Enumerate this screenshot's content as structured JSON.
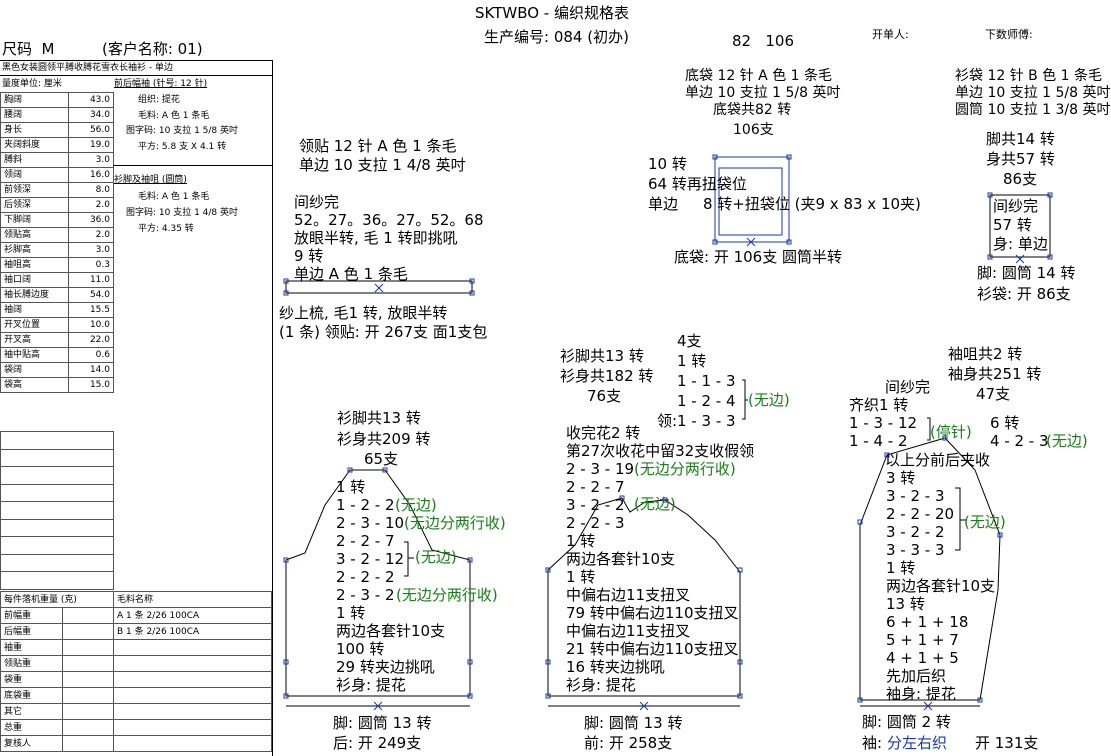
{
  "header": {
    "title": "SKTWBO - 编织规格表",
    "production_no": "生产编号: 084 (初办)",
    "numbers": "82   106",
    "opener_label": "开单人:",
    "counter_label": "下数师傅:",
    "size": "尺码  M",
    "client": "(客户名称: 01)"
  },
  "left": {
    "style_desc": "黑色女装圆领平膊收膊花雪衣长袖衫 - 单边",
    "unit_label": "量度单位: 厘米",
    "measurements": [
      {
        "label": "胸阔",
        "value": "43.0"
      },
      {
        "label": "腰阔",
        "value": "34.0"
      },
      {
        "label": "身长",
        "value": "56.0"
      },
      {
        "label": "夹阔斜度",
        "value": "19.0"
      },
      {
        "label": "膊斜",
        "value": "3.0"
      },
      {
        "label": "领阔",
        "value": "16.0"
      },
      {
        "label": "前领深",
        "value": "8.0"
      },
      {
        "label": "后领深",
        "value": "2.0"
      },
      {
        "label": "下脚阔",
        "value": "36.0"
      },
      {
        "label": "领贴高",
        "value": "2.0"
      },
      {
        "label": "衫脚高",
        "value": "3.0"
      },
      {
        "label": "袖咀高",
        "value": "0.3"
      },
      {
        "label": "袖口阔",
        "value": "11.0"
      },
      {
        "label": "袖长膊边度",
        "value": "54.0"
      },
      {
        "label": "袖阔",
        "value": "15.5"
      },
      {
        "label": "开叉位置",
        "value": "10.0"
      },
      {
        "label": "开叉高",
        "value": "22.0"
      },
      {
        "label": "袖中贴高",
        "value": "0.6"
      },
      {
        "label": "袋阔",
        "value": "14.0"
      },
      {
        "label": "袋高",
        "value": "15.0"
      }
    ],
    "body_section": {
      "title": "前后幅袖 (针号: 12 针)",
      "lines": [
        "组织: 提花",
        "毛料: A 色 1 条毛",
        "图字码: 10 支拉 1 5/8 英吋",
        "平方: 5.8 支 X 4.1 转"
      ]
    },
    "collar_section": {
      "title": "衫脚及袖咀 (圆筒)",
      "lines": [
        "毛料: A 色 1 条毛",
        "图字码: 10 支拉 1 4/8 英吋",
        "平方: 4.35 转"
      ]
    },
    "weights": {
      "header_left": "每件落机重量 (克)",
      "header_right": "毛料名称",
      "rows": [
        {
          "label": "前幅重",
          "yarn": "A  1 条 2/26 100CA"
        },
        {
          "label": "后幅重",
          "yarn": "B  1 条 2/26 100CA"
        },
        {
          "label": "袖重",
          "yarn": ""
        },
        {
          "label": "领贴重",
          "yarn": ""
        },
        {
          "label": "袋重",
          "yarn": ""
        },
        {
          "label": "底袋重",
          "yarn": ""
        },
        {
          "label": "其它",
          "yarn": ""
        },
        {
          "label": "总重",
          "yarn": ""
        },
        {
          "label": "复核人",
          "yarn": ""
        }
      ]
    }
  },
  "collar": {
    "lines": [
      "领贴  12 针 A 色 1 条毛",
      "单边 10 支拉 1 4/8 英吋"
    ],
    "mid": [
      "间纱完",
      "52。27。36。27。52。68",
      "放眼半转, 毛 1 转即挑吼",
      "9 转",
      "单边 A 色 1 条毛"
    ],
    "bottom": [
      "纱上梳, 毛1 转, 放眼半转",
      "(1 条) 领贴: 开 267支 面1支包"
    ]
  },
  "pocket": {
    "top": [
      "底袋  12 针 A 色 1 条毛",
      "单边 10 支拉 1 5/8 英吋",
      "底袋共82 转",
      "106支"
    ],
    "mid": [
      "10 转",
      "64 转再扭袋位",
      "单边",
      "8 转+扭袋位 (夹9 x 83 x 10夹)"
    ],
    "bottom": "底袋: 开 106支 圆筒半转"
  },
  "side_pocket": {
    "top": [
      "衫袋  12 针 B 色 1 条毛",
      "单边 10 支拉 1 5/8 英吋",
      "圆筒 10 支拉 1 3/8 英吋"
    ],
    "mid": [
      "脚共14 转",
      "身共57 转",
      "86支"
    ],
    "inner": [
      "间纱完",
      "57 转",
      "身: 单边"
    ],
    "bottom": [
      "脚: 圆筒 14 转",
      "衫袋: 开 86支"
    ]
  },
  "back": {
    "top": [
      "衫脚共13 转",
      "衫身共209 转",
      "65支"
    ],
    "lines": [
      "1 转",
      "1 - 2 - 2",
      "2 - 3 - 10",
      "2 - 2 - 7",
      "3 - 2 - 12",
      "2 - 2 - 2",
      "2 - 3 - 2",
      "1 转",
      "两边各套针10支",
      "100 转",
      "29 转夹边挑吼",
      "衫身: 提花"
    ],
    "green": [
      "(无边)",
      "(无边分两行收)",
      "(无边)",
      "(无边分两行收)"
    ],
    "bottom": [
      "脚: 圆筒 13 转",
      "后: 开 249支"
    ]
  },
  "front": {
    "top": [
      "衫脚共13 转",
      "衫身共182 转",
      "76支"
    ],
    "neck": [
      "4支",
      "1 转",
      "1 - 1 - 3",
      "1 - 2 - 4",
      "领:1 - 3 - 3"
    ],
    "neck_green": "(无边)",
    "lines": [
      "收完花2 转",
      "第27次收花中留32支收假领",
      "2 - 3 - 19",
      "2 - 2 - 7",
      "3 - 2 - 2",
      "2 - 2 - 3",
      "1 转",
      "两边各套针10支",
      "1 转",
      "中偏右边11支扭叉",
      "79 转中偏右边110支扭叉",
      "中偏右边11支扭叉",
      "21 转中偏右边110支扭叉",
      "16 转夹边挑吼",
      "衫身: 提花"
    ],
    "green": [
      "(无边分两行收)",
      "(无边)"
    ],
    "bottom": [
      "脚: 圆筒 13 转",
      "前: 开 258支"
    ]
  },
  "sleeve": {
    "top": [
      "袖咀共2 转",
      "袖身共251 转",
      "47支"
    ],
    "lines": [
      "间纱完",
      "齐织1 转",
      "1 - 3 - 12",
      "1 - 4 - 2",
      "以上分前后夹收",
      "3 转",
      "3 - 2 - 3",
      "2 - 2 - 20",
      "3 - 2 - 2",
      "3 - 3 - 3",
      "1 转",
      "两边各套针10支",
      "13 转",
      "6 + 1 + 18",
      "5 + 1 + 7",
      "4 + 1 + 5",
      "先加后织",
      "袖身: 提花"
    ],
    "right": [
      "6 转",
      "4 - 2 - 3"
    ],
    "green": [
      "(停针)",
      "(无边)",
      "(无边)"
    ],
    "bottom": [
      "脚: 圆筒 2 转",
      "袖: ",
      "分左右织",
      "开 131支"
    ]
  }
}
